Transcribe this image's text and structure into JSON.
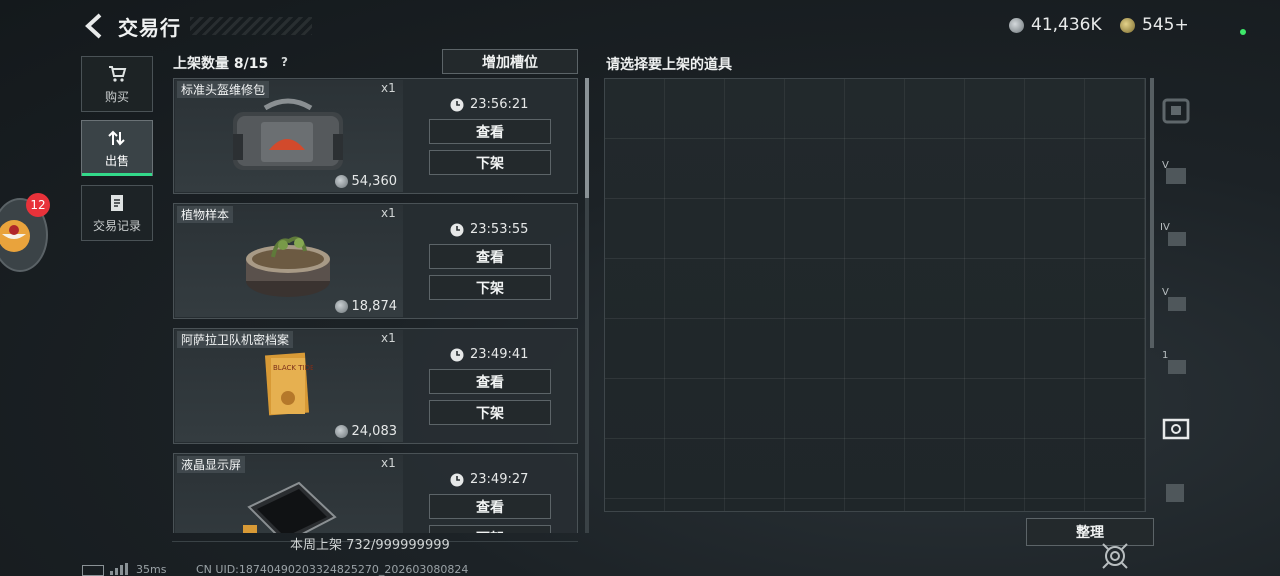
{
  "header": {
    "title": "交易行",
    "currency_1": "41,436K",
    "currency_2": "545+"
  },
  "nav": {
    "buy": "购买",
    "sell": "出售",
    "records": "交易记录"
  },
  "notification_badge": "12",
  "listings": {
    "header": "上架数量 8/15",
    "help": "?",
    "add_slot": "增加槽位",
    "items": [
      {
        "name": "标准头盔维修包",
        "qty": "x1",
        "price": "54,360",
        "timer": "23:56:21",
        "view": "查看",
        "delist": "下架"
      },
      {
        "name": "植物样本",
        "qty": "x1",
        "price": "18,874",
        "timer": "23:53:55",
        "view": "查看",
        "delist": "下架"
      },
      {
        "name": "阿萨拉卫队机密档案",
        "qty": "x1",
        "price": "24,083",
        "timer": "23:49:41",
        "view": "查看",
        "delist": "下架"
      },
      {
        "name": "液晶显示屏",
        "qty": "x1",
        "price": "",
        "timer": "23:49:27",
        "view": "查看",
        "delist": "下架"
      }
    ],
    "weekly": "本周上架 732/999999999"
  },
  "inventory": {
    "prompt": "请选择要上架的道具",
    "sort": "整理",
    "side_tabs": [
      "V",
      "IV",
      "V",
      "1"
    ],
    "doc_text": "BLACK TIDE"
  },
  "footer": {
    "ping": "35ms",
    "uid": "CN UID:1874049020332482527​0_202603080824"
  }
}
